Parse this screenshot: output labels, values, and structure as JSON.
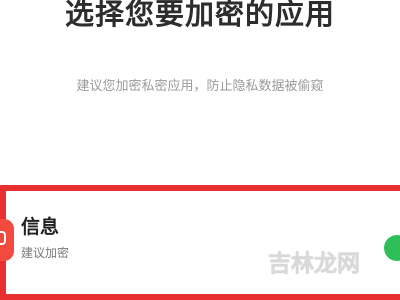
{
  "header": {
    "title": "选择您要加密的应用",
    "subtitle": "建议您加密私密应用，防止隐私数据被偷窥"
  },
  "app_list": [
    {
      "name": "信息",
      "status": "建议加密",
      "icon": "message-icon",
      "toggle_on": true
    }
  ],
  "colors": {
    "highlight_border": "#e7302f",
    "app_icon": "#f24a3f",
    "toggle": "#2fbf5a"
  },
  "watermark": {
    "text": "吉林龙网"
  }
}
